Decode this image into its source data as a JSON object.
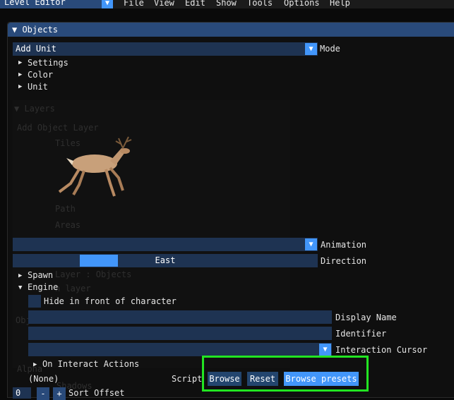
{
  "menubar": {
    "editor_select": "Level Editor",
    "items": [
      "File",
      "View",
      "Edit",
      "Show",
      "Tools",
      "Options",
      "Help"
    ]
  },
  "window": {
    "title": "▼ Objects",
    "mode": {
      "value": "Add Unit",
      "label": "Mode"
    },
    "tree": [
      {
        "arrow": "▶",
        "label": "Settings"
      },
      {
        "arrow": "▶",
        "label": "Color"
      },
      {
        "arrow": "▶",
        "label": "Unit"
      }
    ],
    "background_layers": {
      "header": "▼ Layers",
      "add_label": "Add Object Layer",
      "items": [
        "Tiles",
        "Path",
        "Areas",
        "Layer : Objects",
        "n layer",
        "Alpha",
        "Shadows"
      ],
      "misc": [
        "Objec",
        "Alpha"
      ]
    },
    "animation": {
      "value": "",
      "label": "Animation"
    },
    "direction": {
      "value": "East",
      "label": "Direction",
      "slider_fraction": 0.25
    },
    "spawn": {
      "arrow": "▶",
      "label": "Spawn"
    },
    "engine": {
      "arrow": "▼",
      "label": "Engine"
    },
    "hide_in_front": {
      "label": "Hide in front of character",
      "checked": false
    },
    "display_name": {
      "value": "",
      "label": "Display Name"
    },
    "identifier": {
      "value": "",
      "label": "Identifier"
    },
    "interaction_cursor": {
      "value": "",
      "label": "Interaction Cursor"
    },
    "on_interact": {
      "arrow": "▶",
      "label": "On Interact Actions"
    },
    "script": {
      "value": "(None)",
      "label": "Script"
    },
    "buttons": {
      "browse": "Browse",
      "reset": "Reset",
      "browse_presets": "Browse presets"
    },
    "sort_offset": {
      "value": "0",
      "minus": "-",
      "plus": "+",
      "label": "Sort Offset"
    }
  },
  "colors": {
    "accent": "#4296fa",
    "frame": "#1e3352",
    "title": "#294a7a",
    "highlight": "#22e422"
  }
}
